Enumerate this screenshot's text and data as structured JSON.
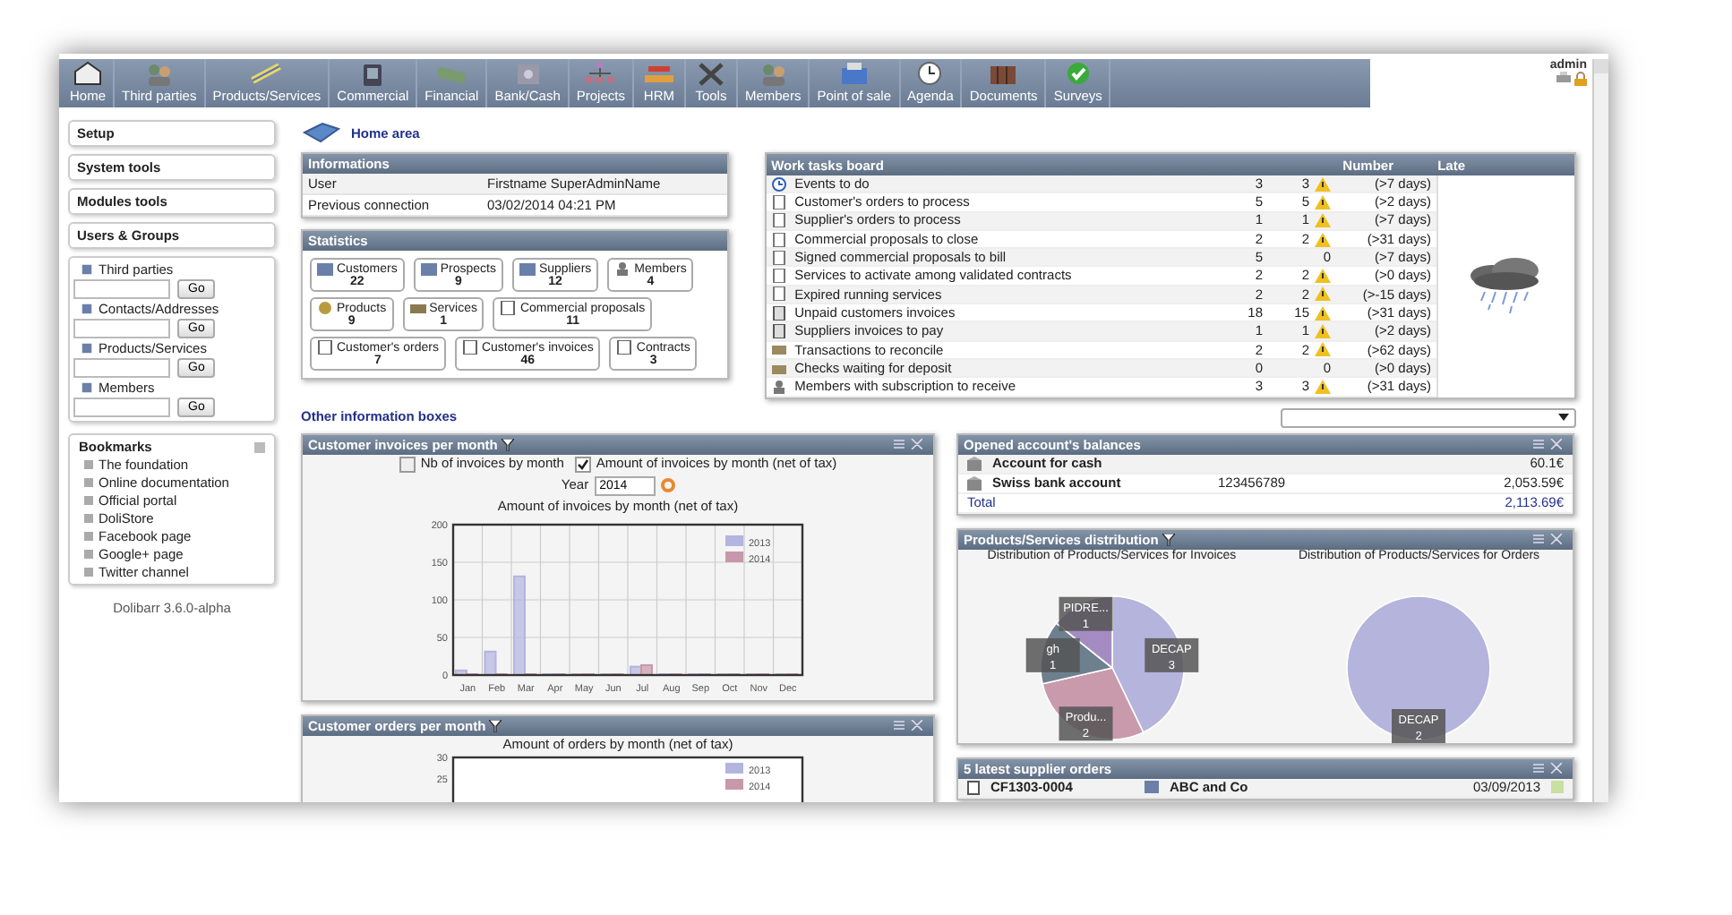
{
  "menu": [
    {
      "label": "Home"
    },
    {
      "label": "Third parties"
    },
    {
      "label": "Products/Services"
    },
    {
      "label": "Commercial"
    },
    {
      "label": "Financial"
    },
    {
      "label": "Bank/Cash"
    },
    {
      "label": "Projects"
    },
    {
      "label": "HRM"
    },
    {
      "label": "Tools"
    },
    {
      "label": "Members"
    },
    {
      "label": "Point of sale"
    },
    {
      "label": "Agenda"
    },
    {
      "label": "Documents"
    },
    {
      "label": "Surveys"
    }
  ],
  "user": {
    "login": "admin"
  },
  "sidebar": {
    "menu": [
      "Setup",
      "System tools",
      "Modules tools",
      "Users & Groups"
    ],
    "searches": [
      {
        "label": "Third parties",
        "button": "Go"
      },
      {
        "label": "Contacts/Addresses",
        "button": "Go"
      },
      {
        "label": "Products/Services",
        "button": "Go"
      },
      {
        "label": "Members",
        "button": "Go"
      }
    ],
    "bookmarks": {
      "title": "Bookmarks",
      "items": [
        "The foundation",
        "Online documentation",
        "Official portal",
        "DoliStore",
        "Facebook page",
        "Google+ page",
        "Twitter channel"
      ]
    },
    "version": "Dolibarr 3.6.0-alpha"
  },
  "page_title": "Home area",
  "informations": {
    "title": "Informations",
    "rows": [
      {
        "label": "User",
        "value": "Firstname SuperAdminName"
      },
      {
        "label": "Previous connection",
        "value": "03/02/2014 04:21 PM"
      }
    ]
  },
  "statistics": {
    "title": "Statistics",
    "items": [
      {
        "label": "Customers",
        "count": "22",
        "kind": "company"
      },
      {
        "label": "Prospects",
        "count": "9",
        "kind": "company"
      },
      {
        "label": "Suppliers",
        "count": "12",
        "kind": "company"
      },
      {
        "label": "Members",
        "count": "4",
        "kind": "member"
      },
      {
        "label": "Products",
        "count": "9",
        "kind": "product"
      },
      {
        "label": "Services",
        "count": "1",
        "kind": "service"
      },
      {
        "label": "Commercial proposals",
        "count": "11",
        "kind": "document"
      },
      {
        "label": "Customer's orders",
        "count": "7",
        "kind": "document"
      },
      {
        "label": "Customer's invoices",
        "count": "46",
        "kind": "document"
      },
      {
        "label": "Contracts",
        "count": "3",
        "kind": "document"
      }
    ]
  },
  "work_board": {
    "title": "Work tasks board",
    "columns": [
      "Number",
      "Late"
    ],
    "rows": [
      {
        "label": "Events to do",
        "number": "3",
        "late": "3",
        "warning": true,
        "delay": "(>7 days)",
        "kind": "event"
      },
      {
        "label": "Customer's orders to process",
        "number": "5",
        "late": "5",
        "warning": true,
        "delay": "(>2 days)",
        "kind": "document"
      },
      {
        "label": "Supplier's orders to process",
        "number": "1",
        "late": "1",
        "warning": true,
        "delay": "(>7 days)",
        "kind": "document"
      },
      {
        "label": "Commercial proposals to close",
        "number": "2",
        "late": "2",
        "warning": true,
        "delay": "(>31 days)",
        "kind": "document"
      },
      {
        "label": "Signed commercial proposals to bill",
        "number": "5",
        "late": "0",
        "warning": false,
        "delay": "(>7 days)",
        "kind": "document"
      },
      {
        "label": "Services to activate among validated contracts",
        "number": "2",
        "late": "2",
        "warning": true,
        "delay": "(>0 days)",
        "kind": "document"
      },
      {
        "label": "Expired running services",
        "number": "2",
        "late": "2",
        "warning": true,
        "delay": "(>-15 days)",
        "kind": "document"
      },
      {
        "label": "Unpaid customers invoices",
        "number": "18",
        "late": "15",
        "warning": true,
        "delay": "(>31 days)",
        "kind": "invoice"
      },
      {
        "label": "Suppliers invoices to pay",
        "number": "1",
        "late": "1",
        "warning": true,
        "delay": "(>2 days)",
        "kind": "invoice"
      },
      {
        "label": "Transactions to reconcile",
        "number": "2",
        "late": "2",
        "warning": true,
        "delay": "(>62 days)",
        "kind": "bank"
      },
      {
        "label": "Checks waiting for deposit",
        "number": "0",
        "late": "0",
        "warning": false,
        "delay": "(>0 days)",
        "kind": "bank"
      },
      {
        "label": "Members with subscription to receive",
        "number": "3",
        "late": "3",
        "warning": true,
        "delay": "(>31 days)",
        "kind": "member"
      }
    ]
  },
  "other_boxes": {
    "title": "Other information boxes"
  },
  "invoices_box": {
    "title": "Customer invoices per month",
    "options": [
      {
        "label": "Nb of invoices by month",
        "checked": false
      },
      {
        "label": "Amount of invoices by month (net of tax)",
        "checked": true
      }
    ],
    "year_label": "Year",
    "year": "2014",
    "chart_data": {
      "type": "bar",
      "title": "Amount of invoices by month (net of tax)",
      "categories": [
        "Jan",
        "Feb",
        "Mar",
        "Apr",
        "May",
        "Jun",
        "Jul",
        "Aug",
        "Sep",
        "Oct",
        "Nov",
        "Dec"
      ],
      "series": [
        {
          "name": "2013",
          "color": "#b4b4e0",
          "values": [
            5,
            30,
            130,
            0,
            0,
            0,
            10,
            0,
            0,
            0,
            0,
            0
          ]
        },
        {
          "name": "2014",
          "color": "#c898aa",
          "values": [
            0,
            0,
            0,
            0,
            0,
            0,
            12,
            0,
            0,
            0,
            0,
            0
          ]
        }
      ],
      "ylim": [
        0,
        200
      ],
      "yticks": [
        0,
        50,
        100,
        150,
        200
      ],
      "grid": true,
      "legend": true
    }
  },
  "orders_box": {
    "title": "Customer orders per month",
    "chart_title": "Amount of orders by month (net of tax)",
    "y_labels": [
      "30",
      "25"
    ],
    "legend": [
      {
        "name": "2013",
        "color": "#b4b4e0"
      },
      {
        "name": "2014",
        "color": "#c898aa"
      }
    ]
  },
  "accounts_box": {
    "title": "Opened account's balances",
    "rows": [
      {
        "name": "Account for cash",
        "number": "",
        "amount": "60.1€"
      },
      {
        "name": "Swiss bank account",
        "number": "123456789",
        "amount": "2,053.59€"
      }
    ],
    "total_label": "Total",
    "total": "2,113.69€"
  },
  "distribution_box": {
    "title": "Products/Services distribution",
    "charts": [
      {
        "chart_data": {
          "type": "pie",
          "title": "Distribution of Products/Services for Invoices",
          "categories": [
            "DECAP",
            "Produ...",
            "gh",
            "PIDRE..."
          ],
          "values": [
            3,
            2,
            1,
            1
          ],
          "data_labels": true
        }
      },
      {
        "chart_data": {
          "type": "pie",
          "title": "Distribution of Products/Services for Orders",
          "categories": [
            "DECAP"
          ],
          "values": [
            2
          ],
          "data_labels": true
        }
      }
    ]
  },
  "supplier_orders_box": {
    "title": "5 latest supplier orders",
    "rows": [
      {
        "ref": "CF1303-0004",
        "company": "ABC and Co",
        "date": "03/09/2013"
      }
    ]
  }
}
